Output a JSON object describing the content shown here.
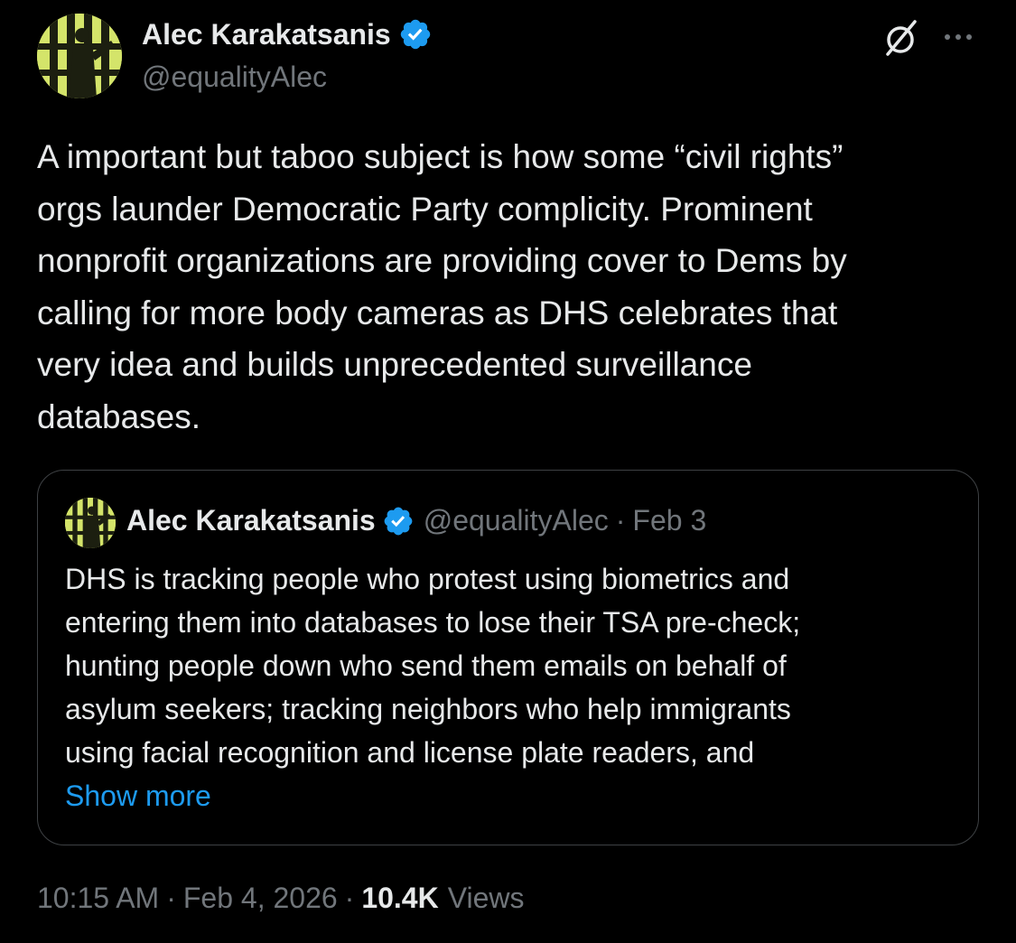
{
  "post": {
    "author": {
      "name": "Alec Karakatsanis",
      "handle": "@equalityAlec",
      "verified": true,
      "avatar_color": "#d4e46a"
    },
    "text_lines": [
      "A important but taboo subject is how some “civil rights”",
      "orgs launder Democratic Party complicity. Prominent",
      "nonprofit organizations are providing cover to Dems by",
      "calling for more body cameras as DHS celebrates that",
      "very idea and builds unprecedented surveillance",
      "databases."
    ],
    "quoted": {
      "name": "Alec Karakatsanis",
      "handle": "@equalityAlec",
      "separator": "·",
      "date": "Feb 3",
      "text_lines": [
        "DHS is tracking people who protest using biometrics and",
        "entering them into databases to lose their TSA pre-check;",
        "hunting people down who send them emails on behalf of",
        "asylum seekers; tracking neighbors who help immigrants",
        "using facial recognition and license plate readers, and"
      ],
      "show_more": "Show more"
    },
    "timestamp": "10:15 AM",
    "date": "Feb 4, 2026",
    "separator": "·",
    "views_count": "10.4K",
    "views_label": "Views"
  },
  "icons": {
    "verified": "verified-badge-icon",
    "grok": "grok-icon",
    "more": "more-icon"
  },
  "colors": {
    "background": "#000000",
    "text": "#e7e9ea",
    "muted": "#71767b",
    "link": "#1d9bf0",
    "verified": "#1d9bf0",
    "border": "#3e4144"
  }
}
